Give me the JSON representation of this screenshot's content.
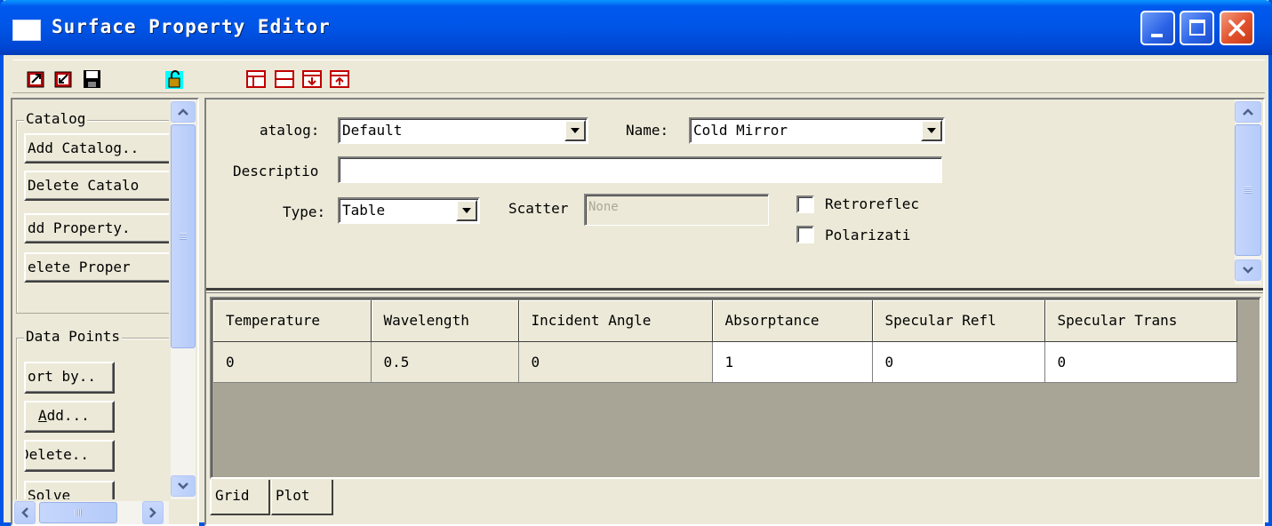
{
  "window": {
    "title": "Surface Property Editor"
  },
  "toolbar": {
    "icons": [
      "import-icon",
      "export-icon",
      "save-icon",
      "unlock-icon",
      "insert-row-icon",
      "delete-row-icon",
      "move-down-icon",
      "move-up-icon"
    ]
  },
  "left_panel": {
    "catalog_group": {
      "title": "Catalog",
      "buttons": [
        "Add Catalog..",
        "Delete Catalog",
        "Add Property..",
        "Delete Property"
      ]
    },
    "data_points_group": {
      "title": "Data Points",
      "buttons": [
        "Sort by..",
        "Add...",
        "Delete..",
        "Solve"
      ]
    },
    "visible_labels": {
      "add_catalog": "Add Catalog..",
      "delete_catalog": "Delete Catalo",
      "add_property": "dd Property.",
      "delete_property": "elete Proper",
      "sort_by": "ort by..",
      "add_prefix": "A",
      "add_rest": "dd...",
      "delete": "Delete..",
      "solve": "Solve"
    }
  },
  "properties": {
    "catalog_label": "atalog:",
    "catalog_value": "Default",
    "name_label": "Name:",
    "name_value": "Cold Mirror",
    "description_label": "Descriptio",
    "description_value": "",
    "type_label": "Type:",
    "type_value": "Table",
    "scatter_label": "Scatter",
    "scatter_value": "None",
    "retroreflect_label": "Retroreflec",
    "retroreflect_checked": false,
    "polarization_label": "Polarizati",
    "polarization_checked": false
  },
  "grid": {
    "columns": [
      "Temperature",
      "Wavelength",
      "Incident Angle",
      "Absorptance",
      "Specular Refl",
      "Specular Trans"
    ],
    "rows": [
      [
        "0",
        "0.5",
        "0",
        "1",
        "0",
        "0"
      ]
    ]
  },
  "tabs": [
    "Grid",
    "Plot"
  ],
  "colors": {
    "titlebar": "#0055e6",
    "face": "#ece9d8",
    "grid_empty": "#a8a597"
  }
}
